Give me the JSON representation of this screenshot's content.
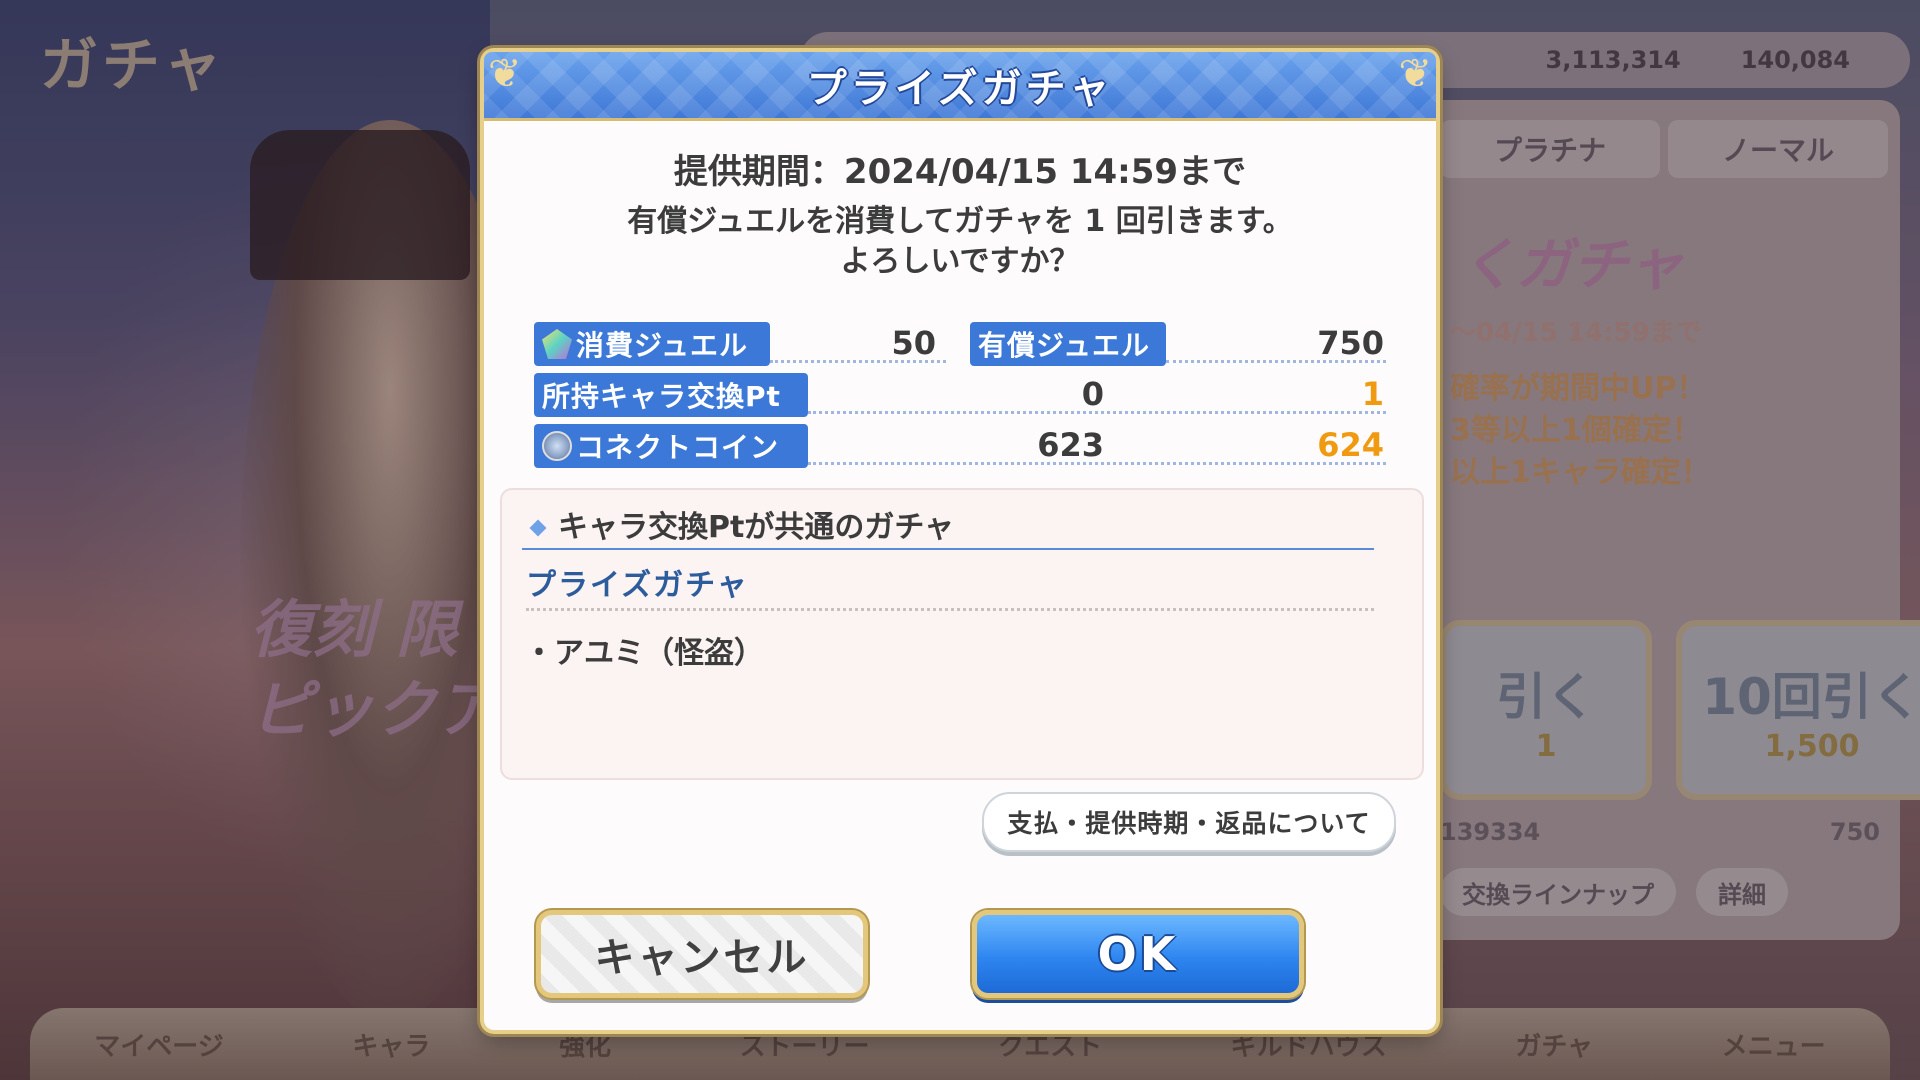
{
  "background": {
    "screen_title": "ガチャ",
    "currency_1": "3,113,314",
    "currency_2": "140,084",
    "tabs": [
      "プラチナ",
      "ノーマル"
    ],
    "banner_text": "くガチャ",
    "banner_date": "～04/15 14:59まで",
    "info_lines": [
      "確率が期間中UP！",
      "3等以上1個確定！",
      "以上1キャラ確定！"
    ],
    "draw_1": {
      "label": "引く",
      "cost": "1"
    },
    "draw_10": {
      "label": "10回引く",
      "cost": "1,500"
    },
    "stock_left": "139334",
    "stock_right": "750",
    "lineup_button": "交換ラインナップ",
    "detail_button": "詳細",
    "left_banner": [
      "復刻 限",
      "ピックア"
    ],
    "nav": [
      "マイページ",
      "キャラ",
      "強化",
      "ストーリー",
      "クエスト",
      "ギルドハウス",
      "ガチャ",
      "メニュー"
    ]
  },
  "dialog": {
    "title": "プライズガチャ",
    "period": "提供期間：2024/04/15 14:59まで",
    "confirm_line1": "有償ジュエルを消費してガチャを 1 回引きます。",
    "confirm_line2": "よろしいですか？",
    "stats": {
      "consume_jewel_label": "消費ジュエル",
      "consume_jewel_value": "50",
      "paid_jewel_label": "有償ジュエル",
      "paid_jewel_value": "750",
      "exchange_pt_label": "所持キャラ交換Pt",
      "exchange_pt_before": "0",
      "exchange_pt_after": "1",
      "connect_coin_label": "コネクトコイン",
      "connect_coin_before": "623",
      "connect_coin_after": "624"
    },
    "info": {
      "heading": "キャラ交換Ptが共通のガチャ",
      "gacha_name": "プライズガチャ",
      "item": "・アユミ（怪盗）"
    },
    "payment_button": "支払・提供時期・返品について",
    "cancel_button": "キャンセル",
    "ok_button": "OK",
    "colors": {
      "header_blue": "#3f78d6",
      "label_blue": "#3c78d8",
      "gained_orange": "#f09a12",
      "frame_gold": "#e3c77d"
    }
  }
}
